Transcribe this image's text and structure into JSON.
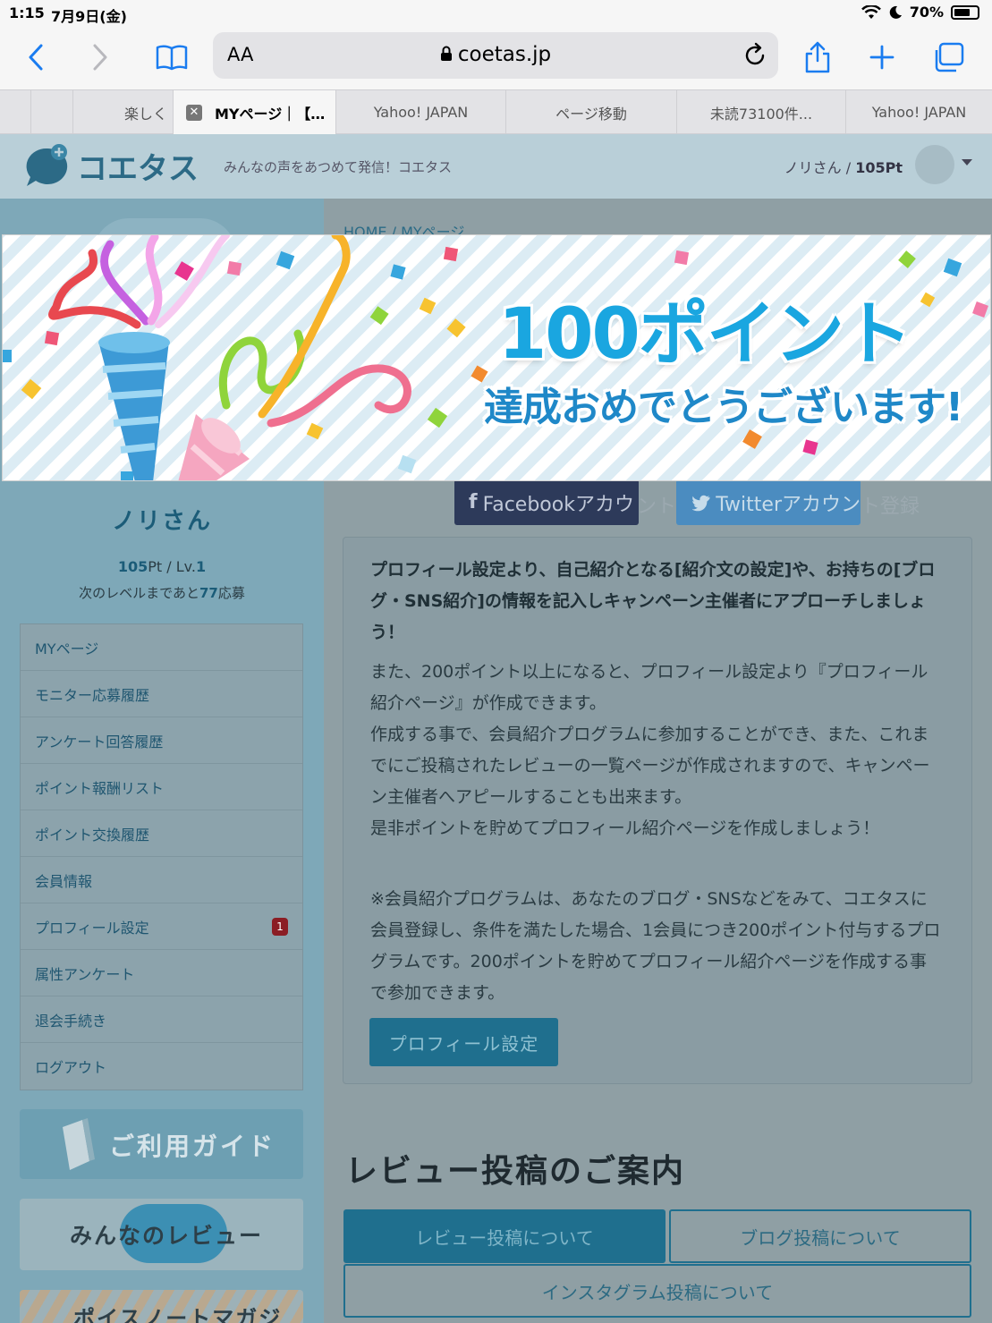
{
  "status_bar": {
    "time": "1:15",
    "date": "7月9日(金)",
    "battery": "70%",
    "battery_level": 0.7
  },
  "browser": {
    "text_size_label": "AA",
    "url": "coetas.jp",
    "tabs": [
      {
        "label": ""
      },
      {
        "label": ""
      },
      {
        "label": "楽しく"
      },
      {
        "label": "MYページ｜【…"
      },
      {
        "label": "Yahoo! JAPAN"
      },
      {
        "label": "ページ移動"
      },
      {
        "label": "未読73100件..."
      },
      {
        "label": "Yahoo! JAPAN"
      }
    ],
    "tab_close": "✕"
  },
  "site": {
    "logo_text": "コエタス",
    "tagline": "みんなの声をあつめて発信！コエタス",
    "user_name": "ノリさん",
    "user_points": "105Pt"
  },
  "breadcrumb": "HOME  /  MYページ",
  "profile": {
    "name": "ノリさん",
    "points": "105",
    "points_unit": "Pt / Lv.",
    "level": "1",
    "next_prefix": "次のレベルまであと",
    "next_value": "77",
    "next_suffix": "応募"
  },
  "menu": [
    {
      "label": "MYページ"
    },
    {
      "label": "モニター応募履歴"
    },
    {
      "label": "アンケート回答履歴"
    },
    {
      "label": "ポイント報酬リスト"
    },
    {
      "label": "ポイント交換履歴"
    },
    {
      "label": "会員情報"
    },
    {
      "label": "プロフィール設定",
      "badge": "1"
    },
    {
      "label": "属性アンケート"
    },
    {
      "label": "退会手続き"
    },
    {
      "label": "ログアウト"
    }
  ],
  "banners": {
    "guide": "ご利用ガイド",
    "review": "みんなのレビュー",
    "magazine": "ポイスノートマガジン"
  },
  "social": {
    "facebook": "Facebookアカウ",
    "facebook_ghost": "ント",
    "twitter": "Twitterアカウン",
    "twitter_ghost": "ト登録"
  },
  "info": {
    "lead": "プロフィール設定より、自己紹介となる[紹介文の設定]や、お持ちの[ブログ・SNS紹介]の情報を記入しキャンペーン主催者にアプローチしましょう！",
    "p1": "また、200ポイント以上になると、プロフィール設定より『プロフィール紹介ページ』が作成できます。\n作成する事で、会員紹介プログラムに参加することができ、また、これまでにご投稿されたレビューの一覧ページが作成されますので、キャンペーン主催者へアピールすることも出来ます。\n是非ポイントを貯めてプロフィール紹介ページを作成しましょう！",
    "p2": "※会員紹介プログラムは、あなたのブログ・SNSなどをみて、コエタスに会員登録し、条件を満たした場合、1会員につき200ポイント付与するプログラムです。200ポイントを貯めてプロフィール紹介ページを作成する事で参加できます。",
    "button": "プロフィール設定"
  },
  "review_section": {
    "heading": "レビュー投稿のご案内",
    "btn_review": "レビュー投稿について",
    "btn_blog": "ブログ投稿について",
    "btn_instagram": "インスタグラム投稿について"
  },
  "modal": {
    "title": "100ポイント",
    "subtitle": "達成おめでとうございます!"
  }
}
